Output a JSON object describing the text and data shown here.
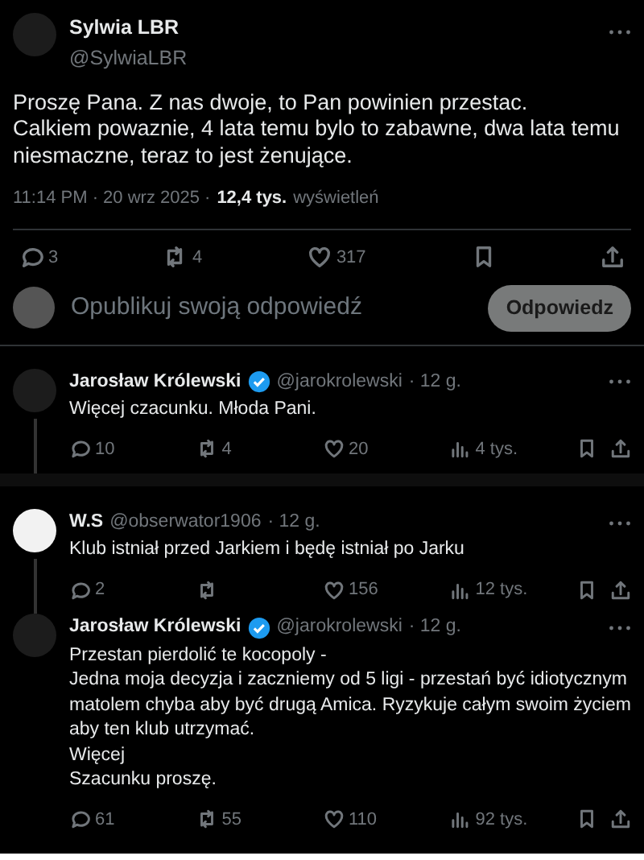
{
  "main_tweet": {
    "name": "Sylwia LBR",
    "handle": "@SylwiaLBR",
    "text": "Proszę Pana. Z nas dwoje, to Pan powinien przestac.\nCalkiem powaznie, 4 lata temu bylo to zabawne, dwa lata temu niesmaczne, teraz to jest żenujące.",
    "time": "11:14 PM · 20 wrz 2025 ·",
    "views_count": "12,4 tys.",
    "views_label": "wyświetleń",
    "replies": "3",
    "reposts": "4",
    "likes": "317"
  },
  "composer": {
    "placeholder": "Opublikuj swoją odpowiedź",
    "button": "Odpowiedz"
  },
  "replies": [
    {
      "name": "Jarosław Królewski",
      "verified": true,
      "handle": "@jarokrolewski",
      "age": "· 12 g.",
      "avatar_light": false,
      "thread_line": true,
      "text": "Więcej czacunku. Młoda Pani.",
      "replies": "10",
      "reposts": "4",
      "likes": "20",
      "views": "4 tys."
    },
    {
      "name": "W.S",
      "verified": false,
      "handle": "@obserwator1906",
      "age": "· 12 g.",
      "avatar_light": true,
      "thread_line": true,
      "text": "Klub istniał przed Jarkiem i będę istniał po Jarku",
      "replies": "2",
      "likes": "156",
      "views": "12 tys."
    },
    {
      "name": "Jarosław Królewski",
      "verified": true,
      "handle": "@jarokrolewski",
      "age": "· 12 g.",
      "avatar_light": false,
      "thread_line": false,
      "text": "Przestan pierdolić te kocopoly -\nJedna moja decyzja i zaczniemy od 5  ligi - przestań być idiotycznym matolem chyba aby być drugą Amica. Ryzykuje całym swoim życiem aby ten klub utrzymać.\nWięcej\nSzacunku proszę.",
      "replies": "61",
      "reposts": "55",
      "likes": "110",
      "views": "92 tys."
    }
  ]
}
